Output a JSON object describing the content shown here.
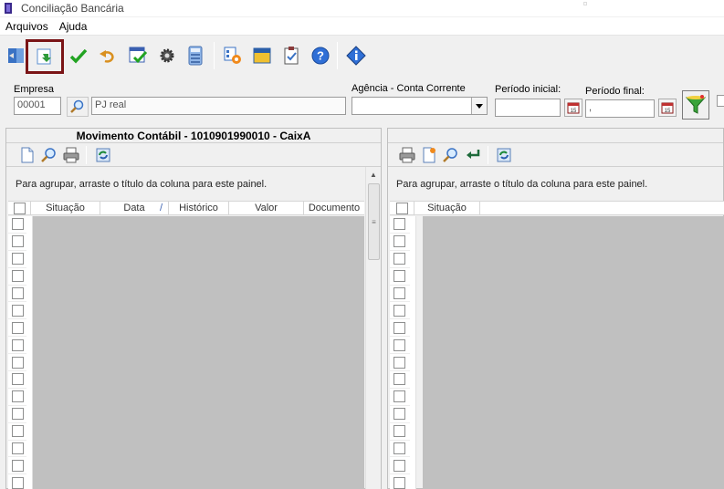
{
  "window": {
    "title": "Conciliação Bancária"
  },
  "menu": {
    "items": [
      "Arquivos",
      "Ajuda"
    ]
  },
  "toolbar": {
    "buttons": [
      {
        "name": "exit-icon"
      },
      {
        "name": "import-icon",
        "highlighted": true
      },
      {
        "name": "checkmark-icon"
      },
      {
        "name": "undo-icon"
      },
      {
        "name": "checklist-icon"
      },
      {
        "name": "gear-icon"
      },
      {
        "name": "calculator-icon"
      },
      {
        "name": "settings-grid-icon"
      },
      {
        "name": "window-icon"
      },
      {
        "name": "clipboard-icon"
      },
      {
        "name": "help-icon"
      },
      {
        "name": "info-icon"
      }
    ]
  },
  "filters": {
    "empresa_label": "Empresa",
    "empresa_code": "00001",
    "empresa_name": "PJ real",
    "agencia_label": "Agência - Conta Corrente",
    "agencia_value": "",
    "periodo_inicial_label": "Período inicial:",
    "periodo_inicial_value": "",
    "periodo_final_label": "Período final:",
    "periodo_final_value": ","
  },
  "left_panel": {
    "title": "Movimento Contábil - 1010901990010 - CaixA",
    "group_hint": "Para agrupar, arraste o título da coluna para este painel.",
    "columns": [
      "Situação",
      "Data",
      "Histórico",
      "Valor",
      "Documento"
    ],
    "sort_indicator": "/"
  },
  "right_panel": {
    "group_hint": "Para agrupar, arraste o título da coluna para este painel.",
    "columns": [
      "Situação"
    ]
  },
  "colors": {
    "highlight_border": "#7a1416",
    "grid_empty": "#c0c0c0"
  }
}
